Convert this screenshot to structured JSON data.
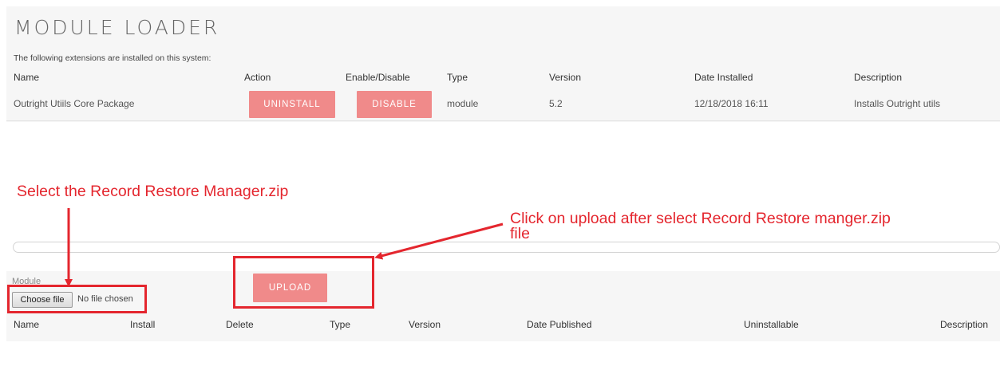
{
  "title": "MODULE LOADER",
  "intro": "The following extensions are installed on this system:",
  "installed_table": {
    "headers": [
      "Name",
      "Action",
      "Enable/Disable",
      "Type",
      "Version",
      "Date Installed",
      "Description"
    ],
    "rows": [
      {
        "name": "Outright Utiils Core Package",
        "action_label": "UNINSTALL",
        "toggle_label": "DISABLE",
        "type": "module",
        "version": "5.2",
        "date_installed": "12/18/2018 16:11",
        "description": "Installs Outright utils"
      }
    ]
  },
  "upload": {
    "module_label": "Module",
    "choose_label": "Choose file",
    "file_status": "No file chosen",
    "upload_label": "UPLOAD"
  },
  "available_table": {
    "headers": [
      "Name",
      "Install",
      "Delete",
      "Type",
      "Version",
      "Date Published",
      "Uninstallable",
      "Description"
    ]
  },
  "annotations": {
    "select_zip": "Select the Record Restore Manager.zip",
    "click_upload_line1": "Click on upload after select Record Restore manger.zip",
    "click_upload_line2": "file",
    "color": "#e4262e"
  },
  "colors": {
    "button_red": "#f08a8a",
    "panel_bg": "#f6f6f6"
  }
}
